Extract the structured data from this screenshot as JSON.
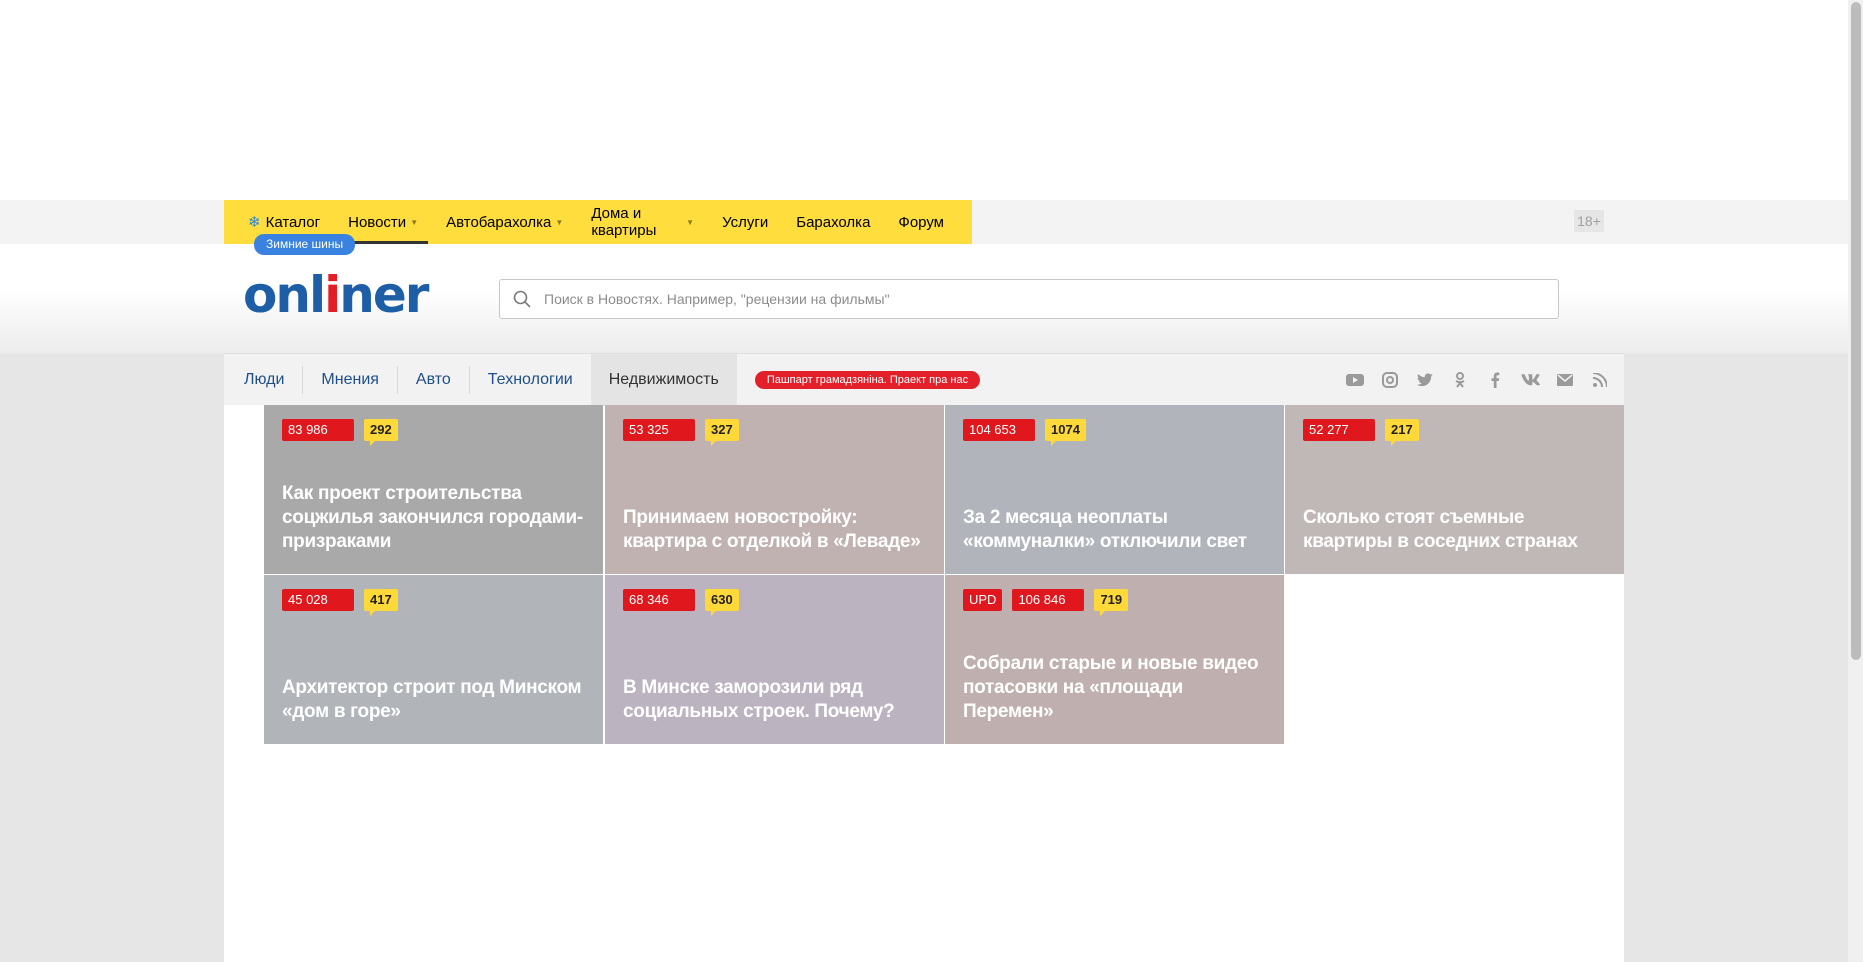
{
  "topnav": {
    "items": [
      {
        "label": "Каталог",
        "icon": "snowflake-icon"
      },
      {
        "label": "Новости",
        "dropdown": true
      },
      {
        "label": "Автобарахолка",
        "dropdown": true
      },
      {
        "label": "Дома и квартиры",
        "dropdown": true
      },
      {
        "label": "Услуги"
      },
      {
        "label": "Барахолка"
      },
      {
        "label": "Форум"
      }
    ],
    "catalog_badge": "Зимние шины",
    "age_rating": "18+"
  },
  "header": {
    "logo_prefix": "onl",
    "logo_accent": "i",
    "logo_suffix": "ner",
    "search_placeholder": "Поиск в Новостях. Например, \"рецензии на фильмы\""
  },
  "subnav": {
    "items": [
      "Люди",
      "Мнения",
      "Авто",
      "Технологии"
    ],
    "active": "Недвижимость",
    "promo": "Пашпарт грамадзяніна. Праект пра нас",
    "socials": [
      "youtube-icon",
      "instagram-icon",
      "twitter-icon",
      "odnoklassniki-icon",
      "facebook-icon",
      "vk-icon",
      "mail-icon",
      "rss-icon"
    ]
  },
  "news": [
    {
      "views": "83 986",
      "comments": "292",
      "title": "Как проект строительства соцжилья закончился городами-призраками",
      "color": "#a9a9a9"
    },
    {
      "views": "53 325",
      "comments": "327",
      "title": "Принимаем новостройку: квартира с отделкой в «Леваде»",
      "color": "#bfb2b0"
    },
    {
      "views": "104 653",
      "comments": "1074",
      "title": "За 2 месяца неоплаты «коммуналки» отключили свет",
      "color": "#b1b5bb"
    },
    {
      "views": "52 277",
      "comments": "217",
      "title": "Сколько стоят съемные квартиры в соседних странах",
      "color": "#bfb8b6"
    },
    {
      "views": "45 028",
      "comments": "417",
      "title": "Архитектор строит под Минском «дом в горе»",
      "color": "#b1b5ba"
    },
    {
      "views": "68 346",
      "comments": "630",
      "title": "В Минске заморозили ряд социальных строек. Почему?",
      "color": "#bbb3bf"
    },
    {
      "upd": "UPD",
      "views": "106 846",
      "comments": "719",
      "title": "Собрали старые и новые видео потасовки на «площади Перемен»",
      "color": "#bfb0af"
    }
  ]
}
